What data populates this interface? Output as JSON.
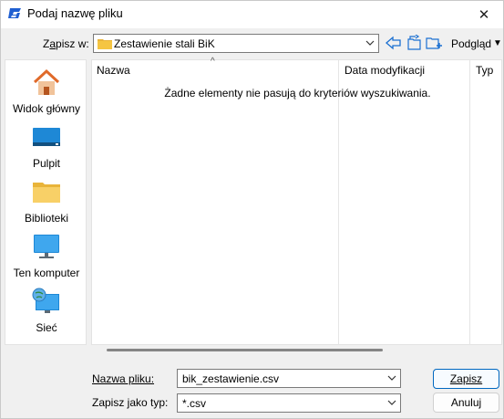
{
  "window": {
    "title": "Podaj nazwę pliku",
    "close_glyph": "✕"
  },
  "toolbar": {
    "save_in_label_pre": "Z",
    "save_in_label_under": "a",
    "save_in_label_post": "pisz w:",
    "location": "Zestawienie stali BiK",
    "view_label": "Podgląd",
    "view_arrow": "▼",
    "icons": [
      "back-arrow-icon",
      "up-folder-icon",
      "new-folder-icon"
    ]
  },
  "places": [
    {
      "label": "Widok główny",
      "icon": "home-icon"
    },
    {
      "label": "Pulpit",
      "icon": "desktop-icon"
    },
    {
      "label": "Biblioteki",
      "icon": "libraries-folder-icon"
    },
    {
      "label": "Ten komputer",
      "icon": "computer-icon"
    },
    {
      "label": "Sieć",
      "icon": "network-icon"
    }
  ],
  "file_list": {
    "columns": [
      "Nazwa",
      "Data modyfikacji",
      "Typ"
    ],
    "empty_message": "Żadne elementy nie pasują do kryteriów wyszukiwania.",
    "sort_glyph": "^"
  },
  "form": {
    "filename_label": "Nazwa pliku:",
    "filename_value": "bik_zestawienie.csv",
    "filetype_label": "Zapisz jako typ:",
    "filetype_value": "*.csv",
    "save_button": "Zapisz",
    "cancel_button": "Anuluj"
  },
  "colors": {
    "accent": "#0067c0",
    "folder": "#f5c542",
    "home_roof": "#e06a2a"
  }
}
